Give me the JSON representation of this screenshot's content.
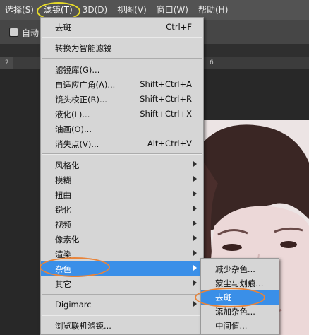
{
  "menubar": {
    "items": [
      "选择(S)",
      "滤镜(T)",
      "3D(D)",
      "视图(V)",
      "窗口(W)",
      "帮助(H)"
    ],
    "active_index": 1
  },
  "options": {
    "auto_label": "自动"
  },
  "ruler": {
    "labels": [
      "2",
      "6"
    ]
  },
  "filter_menu": {
    "items": [
      {
        "label": "去斑",
        "shortcut": "Ctrl+F"
      },
      {
        "label": "转换为智能滤镜",
        "shortcut": ""
      },
      {
        "label": "滤镜库(G)...",
        "shortcut": ""
      },
      {
        "label": "自适应广角(A)...",
        "shortcut": "Shift+Ctrl+A"
      },
      {
        "label": "镜头校正(R)...",
        "shortcut": "Shift+Ctrl+R"
      },
      {
        "label": "液化(L)...",
        "shortcut": "Shift+Ctrl+X"
      },
      {
        "label": "油画(O)...",
        "shortcut": ""
      },
      {
        "label": "消失点(V)...",
        "shortcut": "Alt+Ctrl+V"
      },
      {
        "label": "风格化",
        "shortcut": ""
      },
      {
        "label": "模糊",
        "shortcut": ""
      },
      {
        "label": "扭曲",
        "shortcut": ""
      },
      {
        "label": "锐化",
        "shortcut": ""
      },
      {
        "label": "视频",
        "shortcut": ""
      },
      {
        "label": "像素化",
        "shortcut": ""
      },
      {
        "label": "渲染",
        "shortcut": ""
      },
      {
        "label": "杂色",
        "shortcut": ""
      },
      {
        "label": "其它",
        "shortcut": ""
      },
      {
        "label": "Digimarc",
        "shortcut": ""
      },
      {
        "label": "浏览联机滤镜...",
        "shortcut": ""
      }
    ]
  },
  "noise_submenu": {
    "items": [
      "减少杂色...",
      "蒙尘与划痕...",
      "去斑",
      "添加杂色...",
      "中间值..."
    ]
  },
  "colors": {
    "selection": "#3a8fe8",
    "yellow_marker": "#e8dc28",
    "orange_marker": "#e8843a"
  }
}
